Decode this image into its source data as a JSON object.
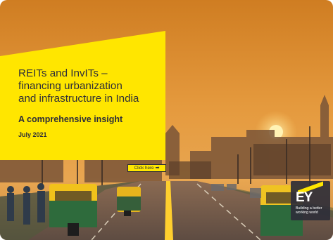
{
  "banner": {
    "title_line1": "REITs and InvITs –",
    "title_line2": "financing urbanization",
    "title_line3": "and infrastructure in India",
    "subtitle": "A comprehensive insight",
    "date": "July 2021",
    "cta_label": "Click here",
    "cta_icon": "arrow-right-icon"
  },
  "logo": {
    "brand": "EY",
    "tagline_line1": "Building a better",
    "tagline_line2": "working world"
  },
  "colors": {
    "accent": "#ffe600",
    "text": "#2e2e38",
    "sky_top": "#d98a2a",
    "sky_bottom": "#e9a34a"
  }
}
